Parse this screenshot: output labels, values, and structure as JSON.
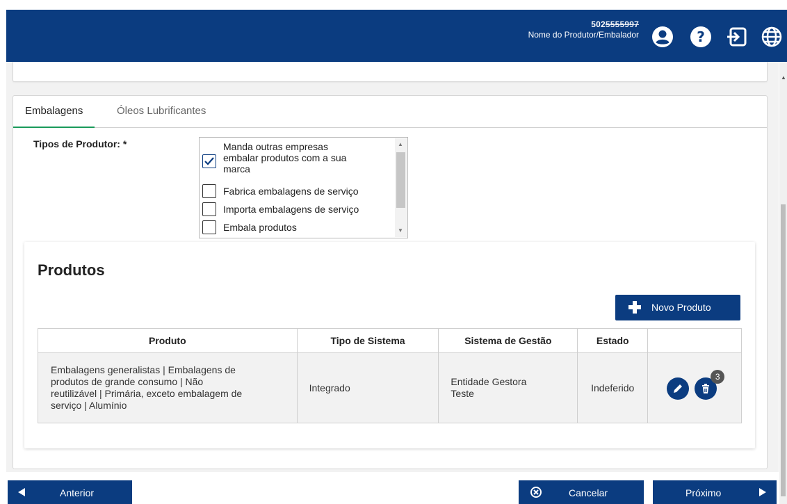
{
  "header": {
    "user_id_visible": "502",
    "user_id_masked": "5555997",
    "user_name": "Nome do Produtor/Embalador",
    "icons": [
      "user-icon",
      "help-icon",
      "logout-icon",
      "globe-icon"
    ],
    "color": "#0b3c80"
  },
  "tabs": [
    {
      "label": "Embalagens",
      "active": true
    },
    {
      "label": "Óleos Lubrificantes",
      "active": false
    }
  ],
  "tipos": {
    "label": "Tipos de Produtor: *",
    "options": [
      {
        "label_lines": [
          "Manda outras empresas",
          "embalar produtos com a sua",
          "marca"
        ],
        "checked": true
      },
      {
        "label_lines": [
          "Fabrica embalagens de serviço"
        ],
        "checked": false
      },
      {
        "label_lines": [
          "Importa embalagens de serviço"
        ],
        "checked": false
      },
      {
        "label_lines": [
          "Embala produtos"
        ],
        "checked": false
      }
    ]
  },
  "produtos": {
    "title": "Produtos",
    "new_button": "Novo Produto",
    "columns": [
      "Produto",
      "Tipo de Sistema",
      "Sistema de Gestão",
      "Estado",
      ""
    ],
    "rows": [
      {
        "produto_lines": [
          "Embalagens generalistas | Embalagens de",
          "produtos de grande consumo | Não",
          "reutilizável | Primária, exceto embalagem de",
          "serviço | Alumínio"
        ],
        "tipo": "Integrado",
        "sistema_lines": [
          "Entidade Gestora",
          "Teste"
        ],
        "estado": "Indeferido",
        "badge": "3"
      }
    ]
  },
  "footer": {
    "anterior": "Anterior",
    "cancelar": "Cancelar",
    "proximo": "Próximo"
  }
}
